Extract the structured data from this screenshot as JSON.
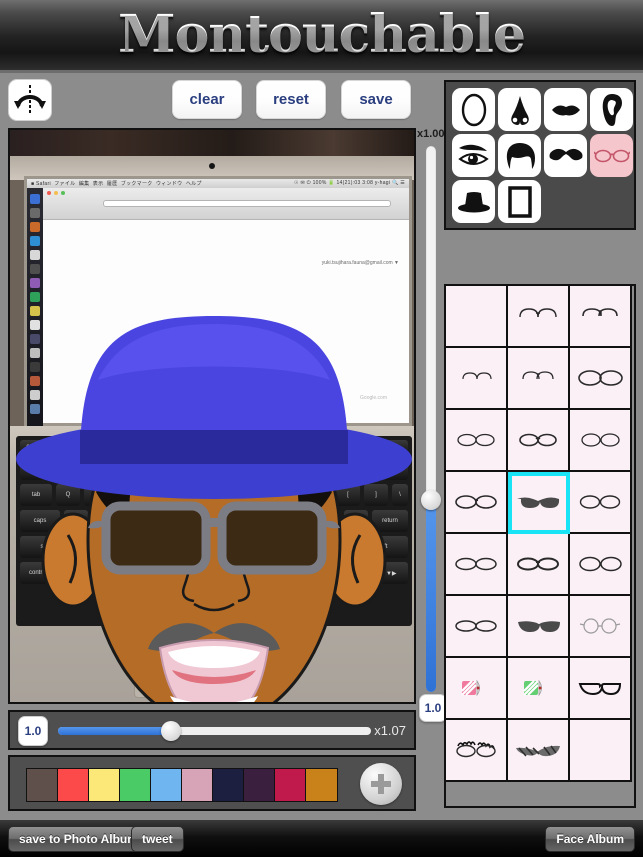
{
  "app": {
    "title": "Montouchable",
    "brand_accent": "#19e4f5",
    "panel_bg": "#8c8c8c"
  },
  "toolbar": {
    "flip_icon": "flip-horizontal-icon",
    "clear_label": "clear",
    "reset_label": "reset",
    "save_label": "save"
  },
  "canvas": {
    "zoom_label": "x1.00",
    "zoom_badge": "1.0",
    "zoom_fill_percent": 35,
    "zoom_thumb_percent": 63
  },
  "scale_slider": {
    "badge": "1.0",
    "multiplier": "x1.07",
    "fill_percent": 37,
    "thumb_percent": 33
  },
  "colors": {
    "swatches": [
      "#60504c",
      "#fc4a4a",
      "#fbe879",
      "#4acb66",
      "#6fb5ef",
      "#d6a3b7",
      "#1c1f3f",
      "#3a1f3f",
      "#c0194b",
      "#c9821a"
    ],
    "add_icon": "plus-circle-icon"
  },
  "categories": {
    "items": [
      {
        "name": "face-icon",
        "label": "face",
        "selected": false
      },
      {
        "name": "nose-icon",
        "label": "nose",
        "selected": false
      },
      {
        "name": "lips-icon",
        "label": "lips",
        "selected": false
      },
      {
        "name": "ear-icon",
        "label": "ear",
        "selected": false
      },
      {
        "name": "eye-icon",
        "label": "eye",
        "selected": false
      },
      {
        "name": "hair-icon",
        "label": "hair",
        "selected": false
      },
      {
        "name": "mustache-icon",
        "label": "mustache",
        "selected": false
      },
      {
        "name": "glasses-icon",
        "label": "glasses",
        "selected": true
      },
      {
        "name": "hat-icon",
        "label": "hat",
        "selected": false
      },
      {
        "name": "frame-icon",
        "label": "frame",
        "selected": false
      }
    ],
    "selected_index": 7,
    "selected_bg": "#f5c6cb"
  },
  "item_grid": {
    "columns": 3,
    "selected_index": 10,
    "cells": [
      {
        "name": "glasses-empty",
        "style": "empty"
      },
      {
        "name": "glasses-halfrim-thin",
        "style": "halfrim"
      },
      {
        "name": "glasses-halfrim-wide",
        "style": "halfrim2"
      },
      {
        "name": "glasses-halfrim-small",
        "style": "halfrim-sm"
      },
      {
        "name": "glasses-halfrim-round",
        "style": "halfrim3"
      },
      {
        "name": "glasses-oval-wide",
        "style": "oval-wide"
      },
      {
        "name": "glasses-oval-thin",
        "style": "oval-thin"
      },
      {
        "name": "glasses-oval-mid",
        "style": "oval-mid"
      },
      {
        "name": "glasses-oval-open",
        "style": "oval-open"
      },
      {
        "name": "glasses-oval-dark-rim",
        "style": "oval-rim"
      },
      {
        "name": "sunglasses-dark-oval",
        "style": "sun-dark"
      },
      {
        "name": "glasses-oval-light",
        "style": "oval-light"
      },
      {
        "name": "glasses-rect-thin",
        "style": "rect-thin"
      },
      {
        "name": "glasses-rect-bold",
        "style": "rect-bold"
      },
      {
        "name": "glasses-rounded-large",
        "style": "round-large"
      },
      {
        "name": "glasses-oval-slim",
        "style": "oval-slim"
      },
      {
        "name": "sunglasses-wrap-dark",
        "style": "sun-wrap"
      },
      {
        "name": "glasses-round-wire",
        "style": "wire-round"
      },
      {
        "name": "eyepatch-pink-stripe",
        "style": "patch-pink"
      },
      {
        "name": "eyepatch-green-stripe",
        "style": "patch-green"
      },
      {
        "name": "glasses-bold-rect",
        "style": "bold-rect"
      },
      {
        "name": "glasses-eyelash",
        "style": "eyelash"
      },
      {
        "name": "sunglasses-cateye-grey",
        "style": "cateye"
      },
      {
        "name": "glasses-empty-2",
        "style": "empty"
      }
    ]
  },
  "bottom_bar": {
    "save_photo_label": "save to Photo Album",
    "tweet_label": "tweet",
    "face_album_label": "Face Album"
  }
}
